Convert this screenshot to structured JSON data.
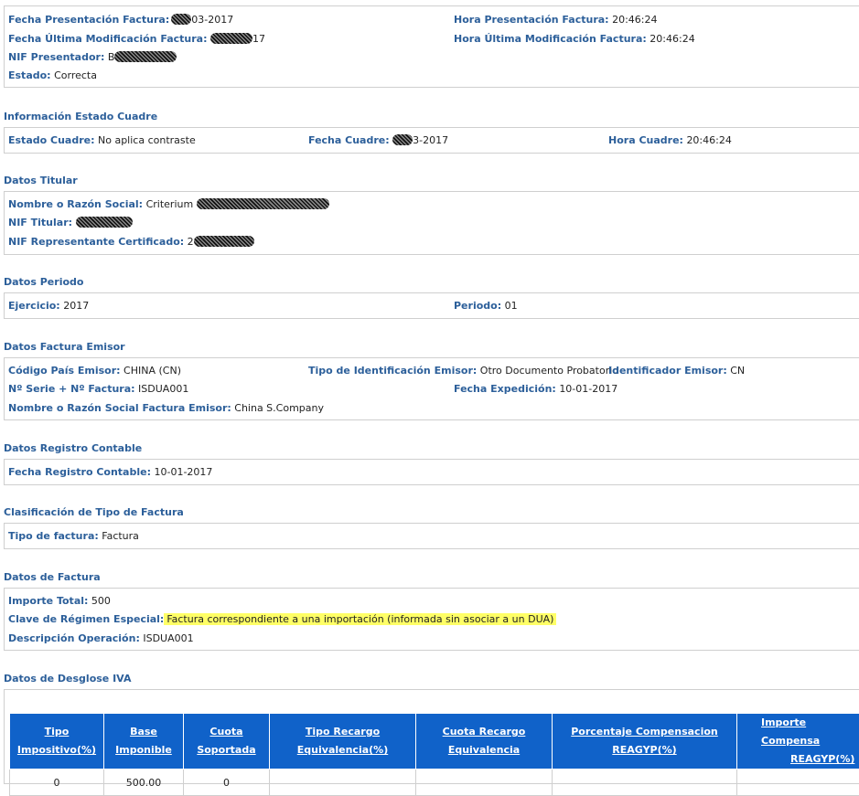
{
  "presentacion": {
    "fecha_label": "Fecha Presentación Factura:",
    "fecha_value": "03-2017",
    "hora_label": "Hora Presentación Factura:",
    "hora_value": "20:46:24",
    "fecha_mod_label": "Fecha Última Modificación Factura:",
    "fecha_mod_value": "17",
    "hora_mod_label": "Hora Última Modificación Factura:",
    "hora_mod_value": "20:46:24",
    "nif_label": "NIF Presentador:",
    "nif_value": "B",
    "estado_label": "Estado:",
    "estado_value": "Correcta"
  },
  "estado_cuadre": {
    "title": "Información Estado Cuadre",
    "estado_label": "Estado Cuadre:",
    "estado_value": "No aplica contraste",
    "fecha_label": "Fecha Cuadre:",
    "fecha_value": "3-2017",
    "hora_label": "Hora Cuadre:",
    "hora_value": "20:46:24"
  },
  "titular": {
    "title": "Datos Titular",
    "nombre_label": "Nombre o Razón Social:",
    "nombre_value": "Criterium",
    "nif_label": "NIF Titular:",
    "nif_rep_label": "NIF Representante Certificado:",
    "nif_rep_value": "2"
  },
  "periodo": {
    "title": "Datos Periodo",
    "ejercicio_label": "Ejercicio:",
    "ejercicio_value": "2017",
    "periodo_label": "Periodo:",
    "periodo_value": "01"
  },
  "emisor": {
    "title": "Datos Factura Emisor",
    "pais_label": "Código País Emisor:",
    "pais_value": "CHINA (CN)",
    "tipo_id_label": "Tipo de Identificación Emisor:",
    "tipo_id_value": "Otro Documento Probatorio",
    "identificador_label": "Identificador Emisor:",
    "identificador_value": "CN",
    "serie_label": "Nº Serie + Nº Factura:",
    "serie_value": "ISDUA001",
    "fecha_exp_label": "Fecha Expedición:",
    "fecha_exp_value": "10-01-2017",
    "nombre_label": "Nombre o Razón Social Factura Emisor:",
    "nombre_value": "China S.Company"
  },
  "registro": {
    "title": "Datos Registro Contable",
    "fecha_label": "Fecha Registro Contable:",
    "fecha_value": "10-01-2017"
  },
  "clasificacion": {
    "title": "Clasificación de Tipo de Factura",
    "tipo_label": "Tipo de factura:",
    "tipo_value": "Factura"
  },
  "factura": {
    "title": "Datos de Factura",
    "importe_label": "Importe Total:",
    "importe_value": "500",
    "clave_label": "Clave de Régimen Especial:",
    "clave_value": "Factura correspondiente a una importación (informada sin asociar a un DUA)",
    "descripcion_label": "Descripción Operación:",
    "descripcion_value": "ISDUA001"
  },
  "desglose": {
    "title": "Datos de Desglose IVA",
    "columns": [
      [
        "Tipo",
        "Impositivo(%)"
      ],
      [
        "Base",
        "Imponible"
      ],
      [
        "Cuota",
        "Soportada"
      ],
      [
        "Tipo Recargo",
        "Equivalencia(%)"
      ],
      [
        "Cuota Recargo",
        "Equivalencia"
      ],
      [
        "Porcentaje Compensacion",
        "REAGYP(%)"
      ],
      [
        "Importe Compensa",
        "REAGYP(%)"
      ]
    ],
    "rows": [
      [
        "0",
        "500.00",
        "0",
        "",
        "",
        "",
        ""
      ]
    ]
  },
  "colors": {
    "label_blue": "#2c5f9a",
    "header_blue": "#1062c9",
    "highlight": "#ffff66"
  }
}
